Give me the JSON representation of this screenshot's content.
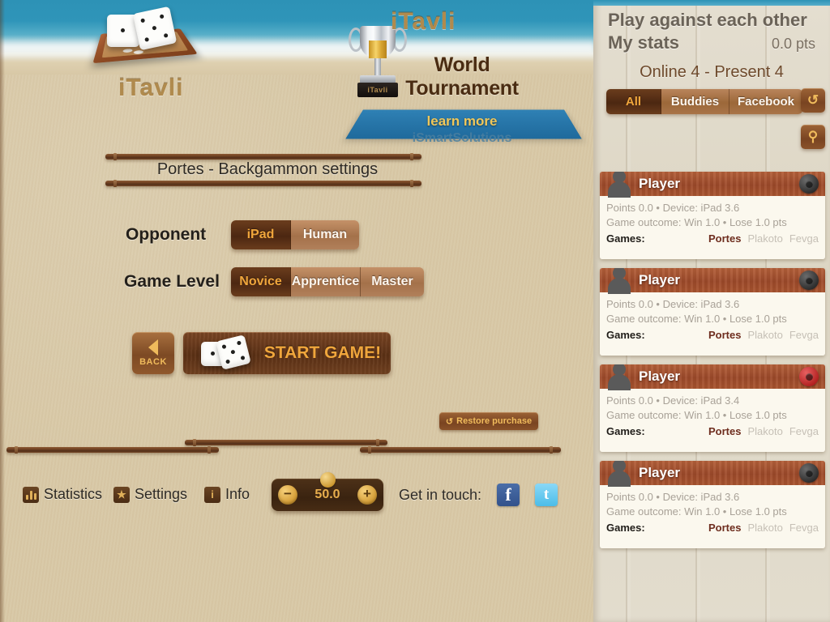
{
  "app": {
    "logo_text": "iTavli",
    "tournament_logo": "iTavli",
    "tournament_line1": "World",
    "tournament_line2": "Tournament",
    "learn_more": "learn more",
    "smart_solutions": "iSmartSolutions",
    "trophy_plate": "iTavli"
  },
  "settings": {
    "title": "Portes - Backgammon settings",
    "opponent": {
      "label": "Opponent",
      "options": [
        {
          "label": "iPad",
          "selected": true
        },
        {
          "label": "Human",
          "selected": false
        }
      ]
    },
    "game_level": {
      "label": "Game Level",
      "options": [
        {
          "label": "Novice",
          "selected": true
        },
        {
          "label": "Apprentice",
          "selected": false
        },
        {
          "label": "Master",
          "selected": false
        }
      ]
    },
    "back_label": "BACK",
    "start_label": "START GAME!",
    "restore_label": "Restore purchase",
    "restore_icon": "↺"
  },
  "toolbar": {
    "statistics": "Statistics",
    "settings": "Settings",
    "info": "Info",
    "settings_icon": "★",
    "info_icon": "i",
    "stepper": {
      "minus": "−",
      "plus": "+",
      "value": "50.0"
    },
    "get_in_touch": "Get in touch:",
    "facebook_icon": "f",
    "twitter_icon": "t"
  },
  "online": {
    "panel_title": "Play against each other",
    "my_stats_label": "My stats",
    "my_points": "0.0 pts",
    "online_present": "Online 4 - Present 4",
    "filters": [
      {
        "label": "All",
        "selected": true
      },
      {
        "label": "Buddies",
        "selected": false
      },
      {
        "label": "Facebook",
        "selected": false
      }
    ],
    "refresh_icon": "↺",
    "search_icon": "⚲",
    "players": [
      {
        "name": "Player",
        "status": "offline",
        "meta1": "Points 0.0 • Device: iPad 3.6",
        "meta2": "Game outcome: Win 1.0 • Lose 1.0 pts",
        "games_label": "Games:",
        "games": [
          {
            "name": "Portes",
            "active": true
          },
          {
            "name": "Plakoto",
            "active": false
          },
          {
            "name": "Fevga",
            "active": false
          }
        ]
      },
      {
        "name": "Player",
        "status": "offline",
        "meta1": "Points 0.0 • Device: iPad 3.6",
        "meta2": "Game outcome: Win 1.0 • Lose 1.0 pts",
        "games_label": "Games:",
        "games": [
          {
            "name": "Portes",
            "active": true
          },
          {
            "name": "Plakoto",
            "active": false
          },
          {
            "name": "Fevga",
            "active": false
          }
        ]
      },
      {
        "name": "Player",
        "status": "online",
        "meta1": "Points 0.0 • Device: iPad 3.4",
        "meta2": "Game outcome: Win 1.0 • Lose 1.0 pts",
        "games_label": "Games:",
        "games": [
          {
            "name": "Portes",
            "active": true
          },
          {
            "name": "Plakoto",
            "active": false
          },
          {
            "name": "Fevga",
            "active": false
          }
        ]
      },
      {
        "name": "Player",
        "status": "offline",
        "meta1": "Points 0.0 • Device: iPad 3.6",
        "meta2": "Game outcome: Win 1.0 • Lose 1.0 pts",
        "games_label": "Games:",
        "games": [
          {
            "name": "Portes",
            "active": true
          },
          {
            "name": "Plakoto",
            "active": false
          },
          {
            "name": "Fevga",
            "active": false
          }
        ]
      }
    ]
  },
  "colors": {
    "sand": "#d8c8a6",
    "sea": "#2d92b6",
    "wood_dark": "#4c2711",
    "wood_light": "#a4714a",
    "accent_gold": "#f0a63c",
    "card_header": "#a9542f",
    "online_red": "#b01f1f",
    "facebook": "#3b5998",
    "twitter": "#5bc8f5"
  }
}
